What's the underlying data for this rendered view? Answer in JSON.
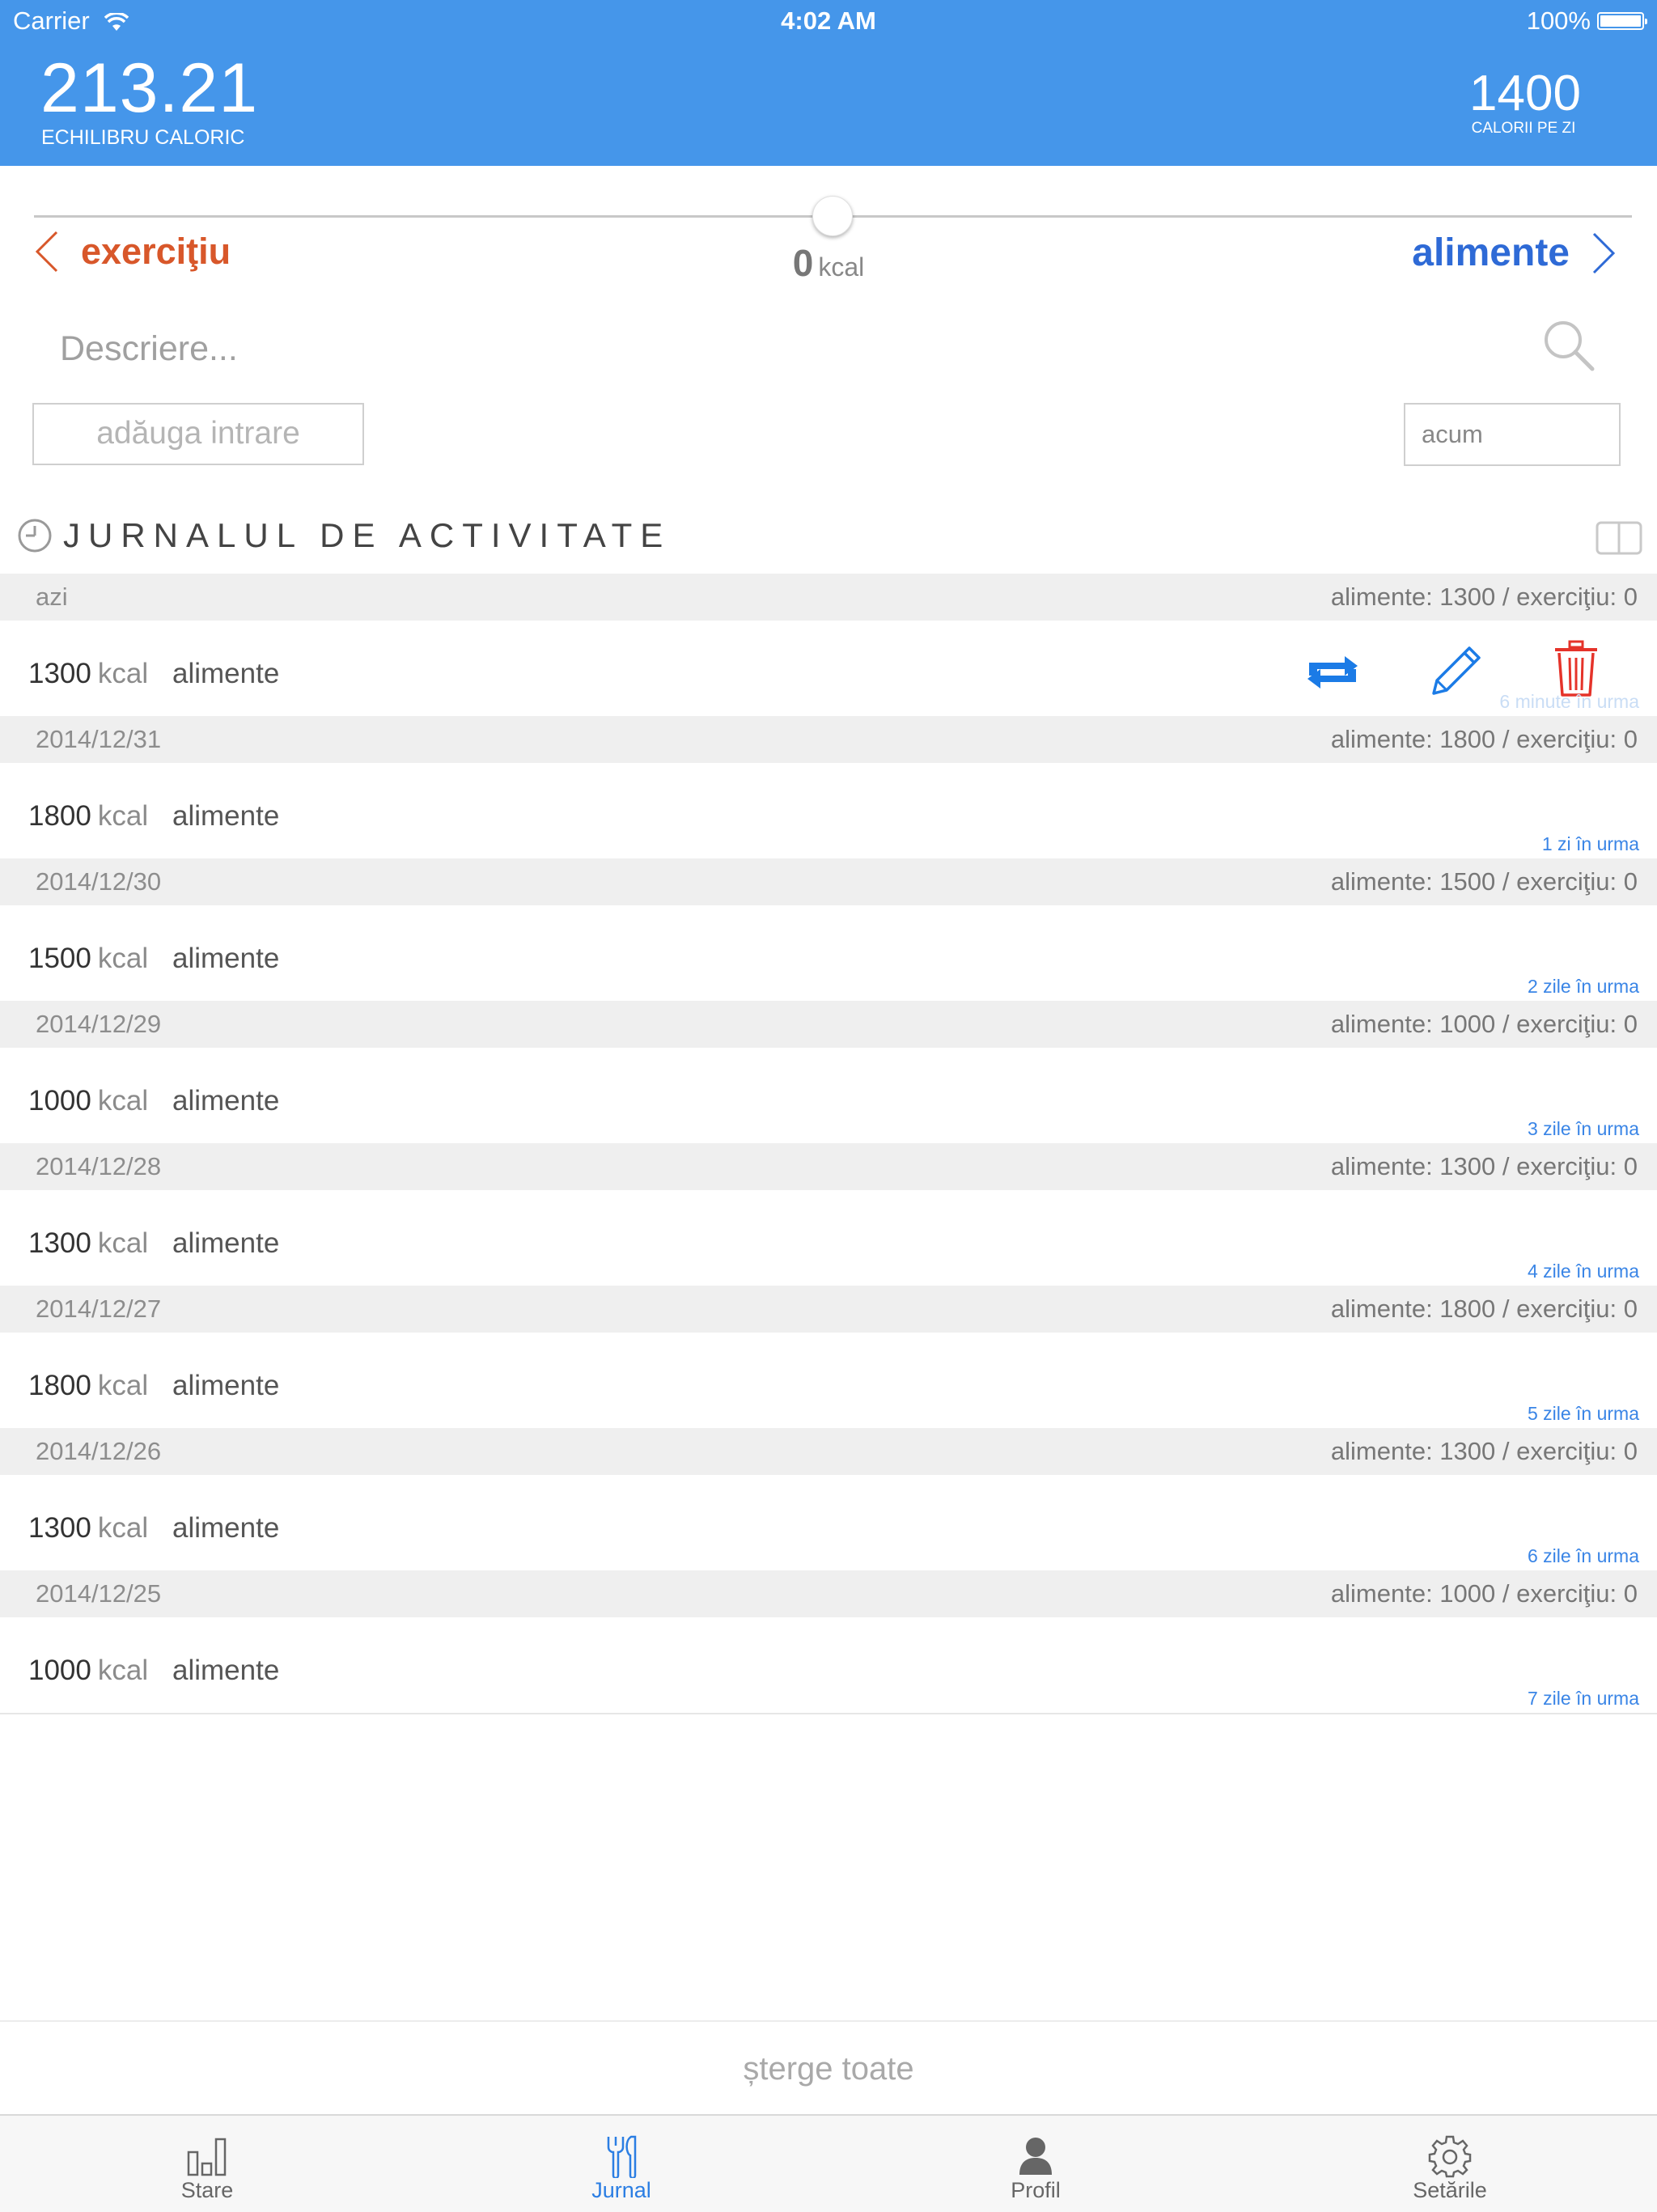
{
  "status": {
    "carrier": "Carrier",
    "time": "4:02 AM",
    "battery": "100%"
  },
  "header": {
    "balance_value": "213.21",
    "balance_label": "ECHILIBRU CALORIC",
    "daily_value": "1400",
    "daily_label": "CALORII PE ZI",
    "color": "#4596ea"
  },
  "selector": {
    "left_label": "exerciţiu",
    "right_label": "alimente",
    "kcal_value": "0",
    "kcal_unit": "kcal",
    "left_color": "#d8572a",
    "right_color": "#2e6ad6"
  },
  "form": {
    "description_placeholder": "Descriere...",
    "add_button": "adăuga intrare",
    "time_value": "acum"
  },
  "log": {
    "title": "JURNALUL DE ACTIVITATE",
    "days": [
      {
        "date": "azi",
        "summary": "alimente: 1300 / exerciţiu: 0",
        "kcal": "1300",
        "unit": "kcal",
        "category": "alimente",
        "ago": "6 minute în urma"
      },
      {
        "date": "2014/12/31",
        "summary": "alimente: 1800 / exerciţiu: 0",
        "kcal": "1800",
        "unit": "kcal",
        "category": "alimente",
        "ago": "1 zi în urma"
      },
      {
        "date": "2014/12/30",
        "summary": "alimente: 1500 / exerciţiu: 0",
        "kcal": "1500",
        "unit": "kcal",
        "category": "alimente",
        "ago": "2 zile în urma"
      },
      {
        "date": "2014/12/29",
        "summary": "alimente: 1000 / exerciţiu: 0",
        "kcal": "1000",
        "unit": "kcal",
        "category": "alimente",
        "ago": "3 zile în urma"
      },
      {
        "date": "2014/12/28",
        "summary": "alimente: 1300 / exerciţiu: 0",
        "kcal": "1300",
        "unit": "kcal",
        "category": "alimente",
        "ago": "4 zile în urma"
      },
      {
        "date": "2014/12/27",
        "summary": "alimente: 1800 / exerciţiu: 0",
        "kcal": "1800",
        "unit": "kcal",
        "category": "alimente",
        "ago": "5 zile în urma"
      },
      {
        "date": "2014/12/26",
        "summary": "alimente: 1300 / exerciţiu: 0",
        "kcal": "1300",
        "unit": "kcal",
        "category": "alimente",
        "ago": "6 zile în urma"
      },
      {
        "date": "2014/12/25",
        "summary": "alimente: 1000 / exerciţiu: 0",
        "kcal": "1000",
        "unit": "kcal",
        "category": "alimente",
        "ago": "7 zile în urma"
      }
    ],
    "row_actions": [
      "repeat-icon",
      "edit-pencil-icon",
      "trash-icon"
    ]
  },
  "clear_all": "șterge toate",
  "tabs": [
    {
      "label": "Stare",
      "icon": "bar-chart-icon"
    },
    {
      "label": "Jurnal",
      "icon": "fork-knife-icon",
      "active": true
    },
    {
      "label": "Profil",
      "icon": "person-icon"
    },
    {
      "label": "Setările",
      "icon": "gear-icon"
    }
  ],
  "colors": {
    "accent": "#2b7ee3",
    "delete": "#e5332a"
  }
}
